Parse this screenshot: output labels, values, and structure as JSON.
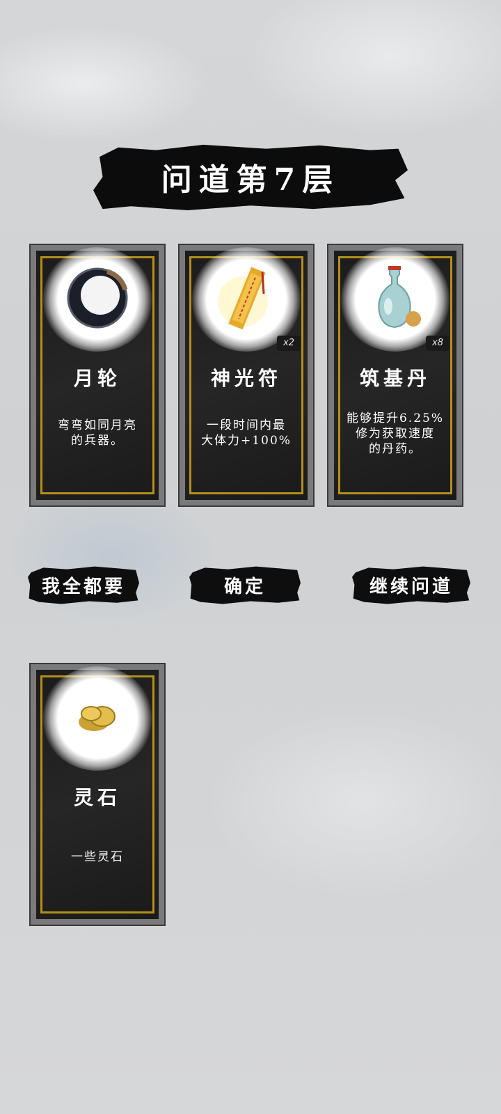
{
  "title": "问道第7层",
  "cards": [
    {
      "name": "月轮",
      "desc": "弯弯如同月亮\n的兵器。",
      "badge": "",
      "icon": "moon-ring-weapon-icon"
    },
    {
      "name": "神光符",
      "desc": "一段时间内最\n大体力+100%",
      "badge": "x2",
      "icon": "talisman-scroll-icon"
    },
    {
      "name": "筑基丹",
      "desc": "能够提升6.25%\n修为获取速度\n的丹药。",
      "badge": "x8",
      "icon": "elixir-vase-icon"
    }
  ],
  "buttons": {
    "take_all": "我全都要",
    "confirm": "确定",
    "continue": "继续问道"
  },
  "reward_card": {
    "name": "灵石",
    "desc": "一些灵石",
    "icon": "spirit-stone-icon"
  },
  "colors": {
    "gold_border": "#b58f1a",
    "ink": "#0e0e0e",
    "background": "#d3d5d7"
  }
}
